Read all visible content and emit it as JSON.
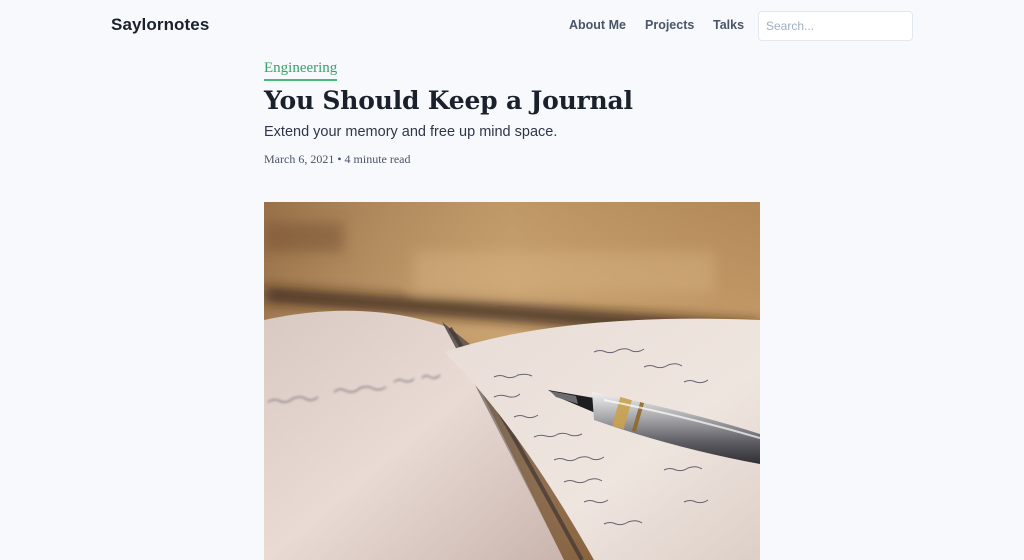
{
  "site": {
    "brand": "Saylornotes"
  },
  "nav": {
    "items": [
      {
        "label": "About Me"
      },
      {
        "label": "Projects"
      },
      {
        "label": "Talks"
      }
    ]
  },
  "search": {
    "placeholder": "Search..."
  },
  "article": {
    "category": "Engineering",
    "title": "You Should Keep a Journal",
    "subtitle": "Extend your memory and free up mind space.",
    "date": "March 6, 2021",
    "separator": "•",
    "read_time": "4 minute read"
  },
  "hero_image": {
    "description_icon": "journal-with-fountain-pen-photo"
  },
  "colors": {
    "background": "#f7f9fc",
    "accent": "#48bb78",
    "text": "#1a202c",
    "muted": "#4a5568"
  }
}
